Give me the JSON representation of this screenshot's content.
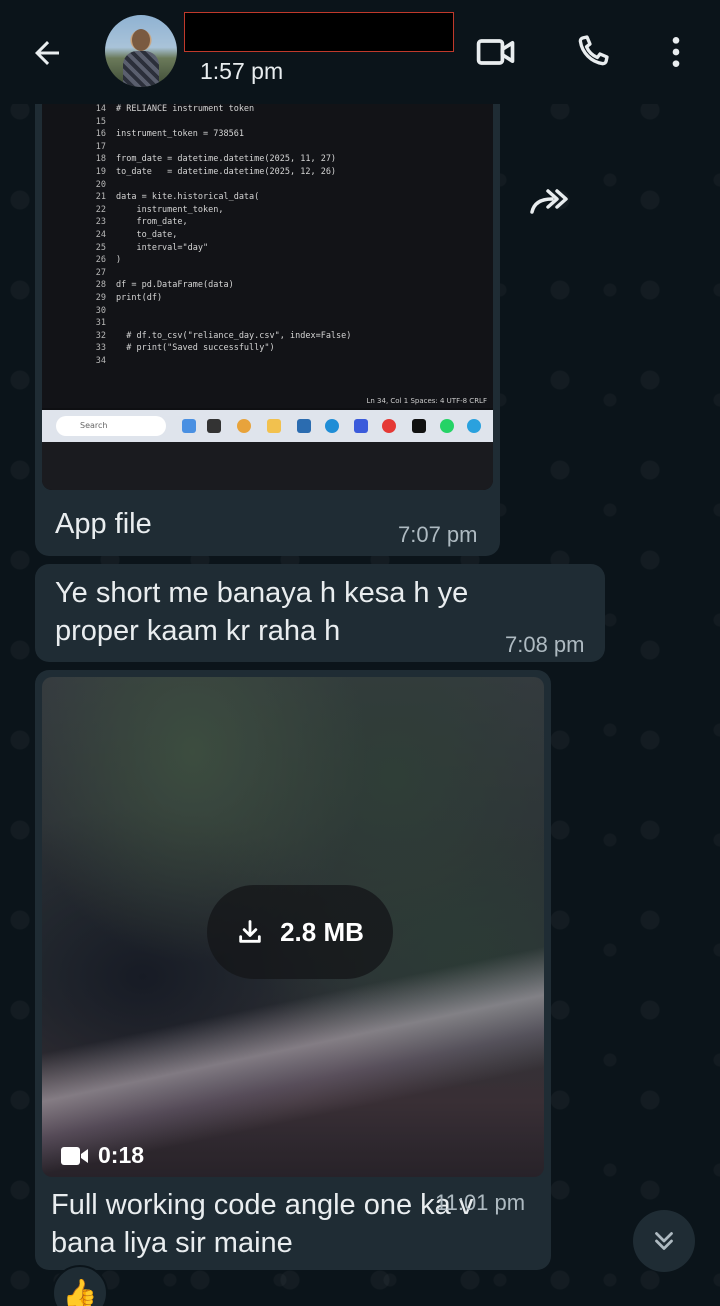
{
  "header": {
    "last_seen": "1:57 pm",
    "icons": [
      "back-arrow-icon",
      "video-call-icon",
      "voice-call-icon",
      "more-vert-icon"
    ]
  },
  "messages": [
    {
      "type": "image",
      "code_lines": [
        {
          "n": "14",
          "text": "# RELIANCE instrument token"
        },
        {
          "n": "15",
          "text": ""
        },
        {
          "n": "16",
          "text": "instrument_token = 738561"
        },
        {
          "n": "17",
          "text": ""
        },
        {
          "n": "18",
          "text": "from_date = datetime.datetime(2025, 11, 27)"
        },
        {
          "n": "19",
          "text": "to_date   = datetime.datetime(2025, 12, 26)"
        },
        {
          "n": "20",
          "text": ""
        },
        {
          "n": "21",
          "text": "data = kite.historical_data("
        },
        {
          "n": "22",
          "text": "    instrument_token,"
        },
        {
          "n": "23",
          "text": "    from_date,"
        },
        {
          "n": "24",
          "text": "    to_date,"
        },
        {
          "n": "25",
          "text": "    interval=\"day\""
        },
        {
          "n": "26",
          "text": ")"
        },
        {
          "n": "27",
          "text": ""
        },
        {
          "n": "28",
          "text": "df = pd.DataFrame(data)"
        },
        {
          "n": "29",
          "text": "print(df)"
        },
        {
          "n": "30",
          "text": ""
        },
        {
          "n": "31",
          "text": ""
        },
        {
          "n": "32",
          "text": "  # df.to_csv(\"reliance_day.csv\", index=False)"
        },
        {
          "n": "33",
          "text": "  # print(\"Saved successfully\")"
        },
        {
          "n": "34",
          "text": ""
        }
      ],
      "status_bar": "Ln 34, Col 1   Spaces: 4   UTF-8   CRLF",
      "taskbar_search": "Search",
      "caption": "App file",
      "time": "7:07 pm"
    },
    {
      "type": "text",
      "text": "Ye short me banaya h kesa h ye proper kaam kr raha h",
      "time": "7:08 pm"
    },
    {
      "type": "video",
      "download_size": "2.8 MB",
      "duration": "0:18",
      "caption": "Full working code angle one ka v bana liya sir maine",
      "time": "11:01 pm",
      "reaction": "👍"
    }
  ]
}
